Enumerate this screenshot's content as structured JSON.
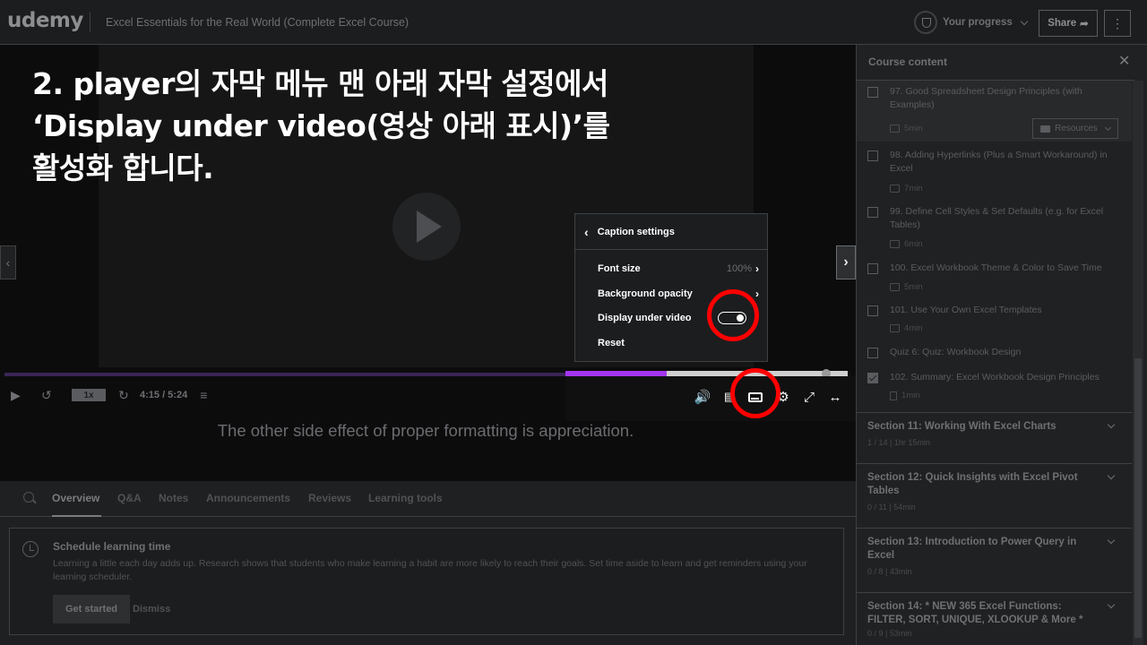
{
  "header": {
    "logo": "udemy",
    "course_title": "Excel Essentials for the Real World (Complete Excel Course)",
    "progress_label": "Your progress",
    "share_label": "Share",
    "more_label": "⋮"
  },
  "instruction": {
    "text": "2. player의 자막 메뉴 맨 아래 자막 설정에서\n‘Display under video(영상 아래 표시)’를\n활성화 합니다."
  },
  "player": {
    "speed": "1x",
    "time": "4:15 / 5:24",
    "progress_fraction": 0.787,
    "caption_text": "The other side effect of proper formatting is appreciation."
  },
  "caption_settings": {
    "title": "Caption settings",
    "font_size_label": "Font size",
    "font_size_value": "100%",
    "background_opacity_label": "Background opacity",
    "display_under_label": "Display under video",
    "display_under_on": true,
    "reset_label": "Reset"
  },
  "tabs": [
    "Overview",
    "Q&A",
    "Notes",
    "Announcements",
    "Reviews",
    "Learning tools"
  ],
  "schedule": {
    "title": "Schedule learning time",
    "body": "Learning a little each day adds up. Research shows that students who make learning a habit are more likely to reach their goals. Set time aside to learn and get reminders using your learning scheduler.",
    "get_started": "Get started",
    "dismiss": "Dismiss"
  },
  "sidebar": {
    "title": "Course content",
    "resources_label": "Resources",
    "lectures": [
      {
        "title": "97. Good Spreadsheet Design Principles (with Examples)",
        "duration": "5min",
        "type": "video",
        "checked": false
      },
      {
        "title": "98. Adding Hyperlinks (Plus a Smart Workaround) in Excel",
        "duration": "7min",
        "type": "video",
        "checked": false
      },
      {
        "title": "99. Define Cell Styles & Set Defaults (e.g. for Excel Tables)",
        "duration": "6min",
        "type": "video",
        "checked": false
      },
      {
        "title": "100. Excel Workbook Theme & Color to Save Time",
        "duration": "5min",
        "type": "video",
        "checked": false
      },
      {
        "title": "101. Use Your Own Excel Templates",
        "duration": "4min",
        "type": "video",
        "checked": false
      },
      {
        "title": "Quiz 6: Quiz: Workbook Design",
        "duration": "",
        "type": "quiz",
        "checked": false
      },
      {
        "title": "102. Summary: Excel Workbook Design Principles",
        "duration": "1min",
        "type": "doc",
        "checked": true
      }
    ],
    "sections": [
      {
        "title": "Section 11: Working With Excel Charts",
        "meta": "1 / 14 | 1hr 15min"
      },
      {
        "title": "Section 12: Quick Insights with Excel Pivot Tables",
        "meta": "0 / 11 | 54min"
      },
      {
        "title": "Section 13: Introduction to Power Query in Excel",
        "meta": "0 / 8 | 43min"
      },
      {
        "title": "Section 14: * NEW 365 Excel Functions: FILTER, SORT, UNIQUE, XLOOKUP & More *",
        "meta": "0 / 9 | 53min"
      }
    ]
  },
  "colors": {
    "accent_purple": "#a435f0",
    "annotation_red": "#ff0000"
  }
}
